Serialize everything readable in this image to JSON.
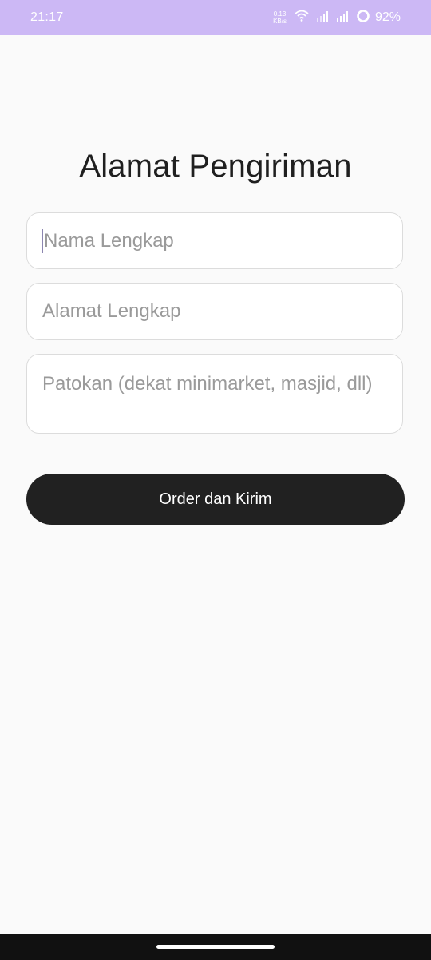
{
  "status_bar": {
    "time": "21:17",
    "net_speed_value": "0.13",
    "net_speed_unit": "KB/s",
    "battery_percent": "92%",
    "icons": [
      "wifi-icon",
      "signal-icon",
      "signal-icon",
      "battery-ring-icon"
    ],
    "background_color": "#ccb8f5"
  },
  "page": {
    "title": "Alamat Pengiriman"
  },
  "form": {
    "name_placeholder": "Nama Lengkap",
    "address_placeholder": "Alamat Lengkap",
    "landmark_placeholder": "Patokan (dekat minimarket, masjid, dll)",
    "submit_label": "Order dan Kirim"
  },
  "colors": {
    "button_background": "#212121",
    "nav_bar": "#111111"
  }
}
